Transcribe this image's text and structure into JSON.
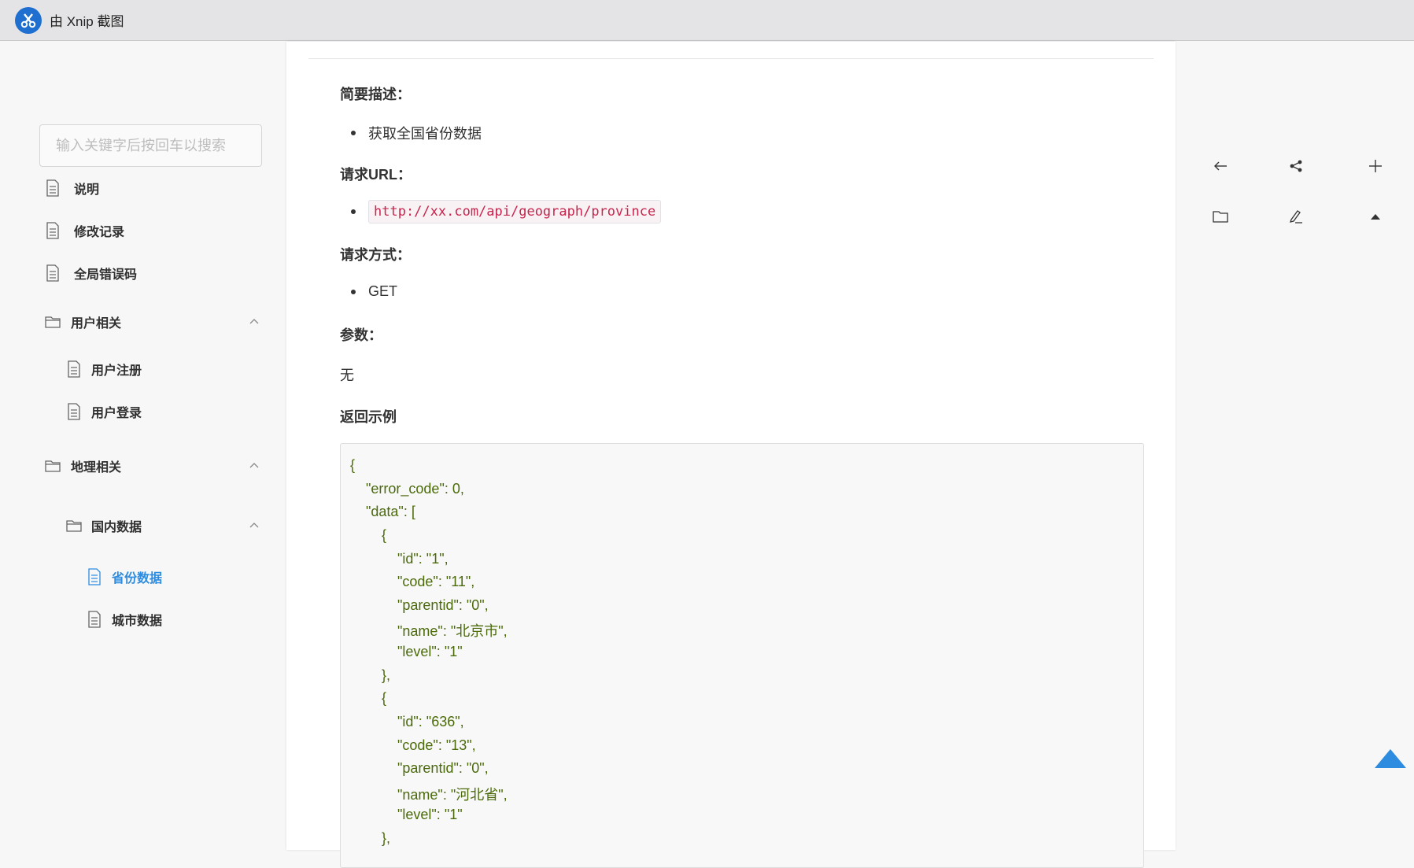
{
  "titlebar": {
    "title": "由 Xnip 截图",
    "logo_glyph": "✂"
  },
  "sidebar": {
    "search_placeholder": "输入关键字后按回车以搜索",
    "items": [
      {
        "label": "说明",
        "type": "doc"
      },
      {
        "label": "修改记录",
        "type": "doc"
      },
      {
        "label": "全局错误码",
        "type": "doc"
      },
      {
        "label": "用户相关",
        "type": "folder",
        "expanded": true
      },
      {
        "label": "用户注册",
        "type": "doc"
      },
      {
        "label": "用户登录",
        "type": "doc"
      },
      {
        "label": "地理相关",
        "type": "folder",
        "expanded": true
      },
      {
        "label": "国内数据",
        "type": "folder",
        "expanded": true
      },
      {
        "label": "省份数据",
        "type": "doc",
        "active": true
      },
      {
        "label": "城市数据",
        "type": "doc"
      }
    ]
  },
  "content": {
    "desc_title": "简要描述：",
    "desc_item": "获取全国省份数据",
    "url_title": "请求URL：",
    "url_value": "http://xx.com/api/geograph/province",
    "method_title": "请求方式：",
    "method_value": "GET",
    "params_title": "参数：",
    "params_value": "无",
    "return_title": "返回示例",
    "code_lines": [
      "{",
      "    \"error_code\": 0,",
      "    \"data\": [",
      "        {",
      "            \"id\": \"1\",",
      "            \"code\": \"11\",",
      "            \"parentid\": \"0\",",
      "            \"name\": \"北京市\",",
      "            \"level\": \"1\"",
      "        },",
      "        {",
      "            \"id\": \"636\",",
      "            \"code\": \"13\",",
      "            \"parentid\": \"0\",",
      "            \"name\": \"河北省\",",
      "            \"level\": \"1\"",
      "        },"
    ]
  },
  "toolbar": {
    "icons": [
      "arrow-left-icon",
      "share-icon",
      "plus-icon",
      "folder-icon",
      "edit-icon",
      "caret-up-icon"
    ]
  },
  "colors": {
    "accent": "#2d8ce0",
    "code_text": "#4b6a0a",
    "inline_code": "#c7254e",
    "back_to_top": "#2d8ce0"
  }
}
